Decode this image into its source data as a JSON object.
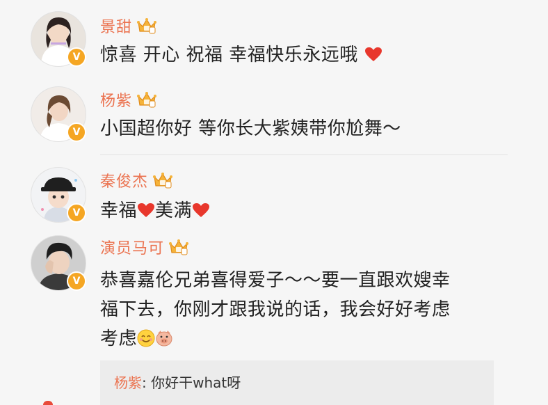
{
  "comments": [
    {
      "username": "景甜",
      "text": "惊喜 开心 祝福 幸福快乐永远哦",
      "badge": "V"
    },
    {
      "username": "杨紫",
      "text": "小国超你好 等你长大紫姨带你尬舞～",
      "badge": "V"
    },
    {
      "username": "秦俊杰",
      "text_part1": "幸福",
      "text_part2": "美满",
      "badge": "V"
    },
    {
      "username": "演员马可",
      "line1": "恭喜嘉伦兄弟喜得爱子～～要一直跟欢嫂幸",
      "line2": "福下去，你刚才跟我说的话，我会好好考虑",
      "line3": "考虑",
      "badge": "V"
    }
  ],
  "reply": {
    "name": "杨紫",
    "separator": ": ",
    "text": "你好干what呀"
  },
  "colors": {
    "username": "#eb7350",
    "verified": "#f5a623",
    "heart": "#e8372c",
    "text": "#222222"
  },
  "icons": {
    "crown": "vip-crown-icon",
    "heart": "heart-icon",
    "smile": "smile-emoji-icon",
    "pig": "pig-emoji-icon"
  }
}
